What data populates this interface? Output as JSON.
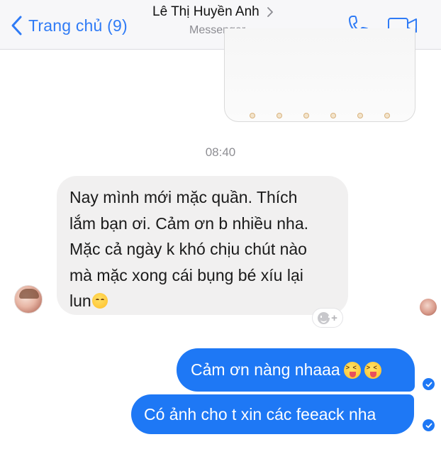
{
  "header": {
    "back_label": "Trang chủ (9)",
    "title": "Lê Thị Huyền Anh",
    "subtitle": "Messenger",
    "accent_color": "#2f7bf6",
    "icons": [
      "chevron-left-icon",
      "chevron-right-icon",
      "phone-icon",
      "video-camera-icon"
    ]
  },
  "conversation": {
    "timestamp": "08:40",
    "incoming": {
      "text": "Nay mình mới mặc quần. Thích\nlắm bạn ơi. Cảm ơn b nhiều nha.\nMặc cả ngày k khó chịu chút nào\nmà mặc xong cái bụng bé xíu lại\nlun",
      "trailing_emoji": "smiling-face-emoji"
    },
    "reaction_button": "+",
    "outgoing": [
      {
        "text": "Cảm ơn nàng nhaaa",
        "emoji_count": 2,
        "emoji": "squinting-tongue-emoji"
      },
      {
        "text": "Có ảnh cho t xin các feeack nha"
      }
    ],
    "bubble_color": "#1e78f5"
  }
}
